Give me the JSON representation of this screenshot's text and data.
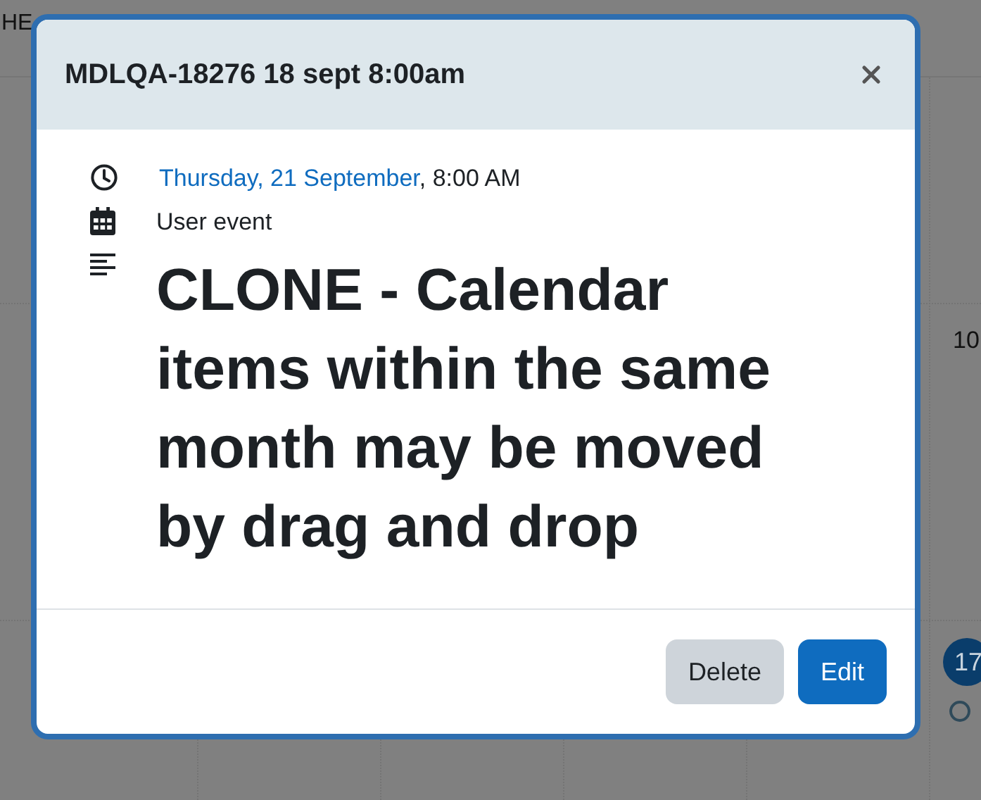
{
  "background": {
    "header_text": "HE",
    "day_number": "10",
    "day_badge": "17"
  },
  "modal": {
    "title": "MDLQA-18276 18 sept 8:00am",
    "date_link": "Thursday, 21 September",
    "time": ", 8:00 AM",
    "event_type": "User event",
    "description": "CLONE - Calendar items within the same month may be moved by drag and drop",
    "buttons": [
      {
        "label": "Delete",
        "kind": "secondary"
      },
      {
        "label": "Edit",
        "kind": "primary"
      }
    ]
  }
}
